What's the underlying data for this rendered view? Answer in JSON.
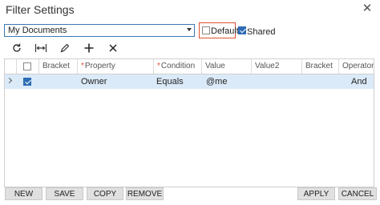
{
  "title": "Filter Settings",
  "filter_select": {
    "value": "My Documents"
  },
  "options": {
    "default_label": "Default",
    "default_checked": false,
    "shared_label": "Shared",
    "shared_checked": true
  },
  "toolbar": {
    "icons": [
      "refresh-icon",
      "fit-columns-icon",
      "edit-icon",
      "add-icon",
      "delete-icon"
    ]
  },
  "grid": {
    "columns": [
      "",
      "Bracket",
      "Property",
      "Condition",
      "Value",
      "Value2",
      "Bracket",
      "Operator"
    ],
    "required_columns": [
      "Property",
      "Condition"
    ],
    "rows": [
      {
        "selected": true,
        "checked": true,
        "bracket": "",
        "property": "Owner",
        "condition": "Equals",
        "value": "@me",
        "value2": "",
        "bracket2": "",
        "operator": "And"
      }
    ]
  },
  "buttons": {
    "new": "NEW",
    "save": "SAVE",
    "copy": "COPY",
    "remove": "REMOVE",
    "apply": "APPLY",
    "cancel": "CANCEL"
  },
  "colors": {
    "accent": "#2d6db5",
    "highlight_border": "#e2522f",
    "selected_row": "#dbeaf8"
  }
}
